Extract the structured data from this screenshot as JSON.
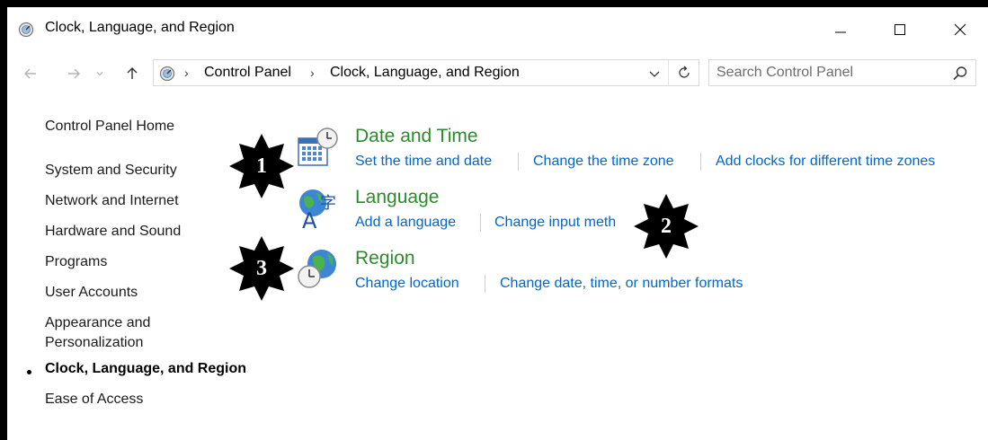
{
  "window": {
    "title": "Clock, Language, and Region"
  },
  "breadcrumb": [
    "Control Panel",
    "Clock, Language, and Region"
  ],
  "search": {
    "placeholder": "Search Control Panel"
  },
  "sidebar": {
    "items": [
      {
        "label": "Control Panel Home"
      },
      {
        "label": "System and Security"
      },
      {
        "label": "Network and Internet"
      },
      {
        "label": "Hardware and Sound"
      },
      {
        "label": "Programs"
      },
      {
        "label": "User Accounts"
      },
      {
        "label": "Appearance and"
      },
      {
        "label": "Personalization"
      },
      {
        "label": "Clock, Language, and Region",
        "current": true
      },
      {
        "label": "Ease of Access"
      }
    ]
  },
  "categories": [
    {
      "title": "Date and Time",
      "icon": "calendar-clock-icon",
      "links": [
        "Set the time and date",
        "Change the time zone",
        "Add clocks for different time zones"
      ]
    },
    {
      "title": "Language",
      "icon": "language-globe-icon",
      "links": [
        "Add a language",
        "Change input meth"
      ]
    },
    {
      "title": "Region",
      "icon": "globe-clock-icon",
      "links": [
        "Change location",
        "Change date, time, or number formats"
      ]
    }
  ],
  "markers": [
    "1",
    "2",
    "3"
  ],
  "colors": {
    "category_title": "#2a8c2a",
    "link": "#0066cc",
    "marker": "#000000"
  }
}
